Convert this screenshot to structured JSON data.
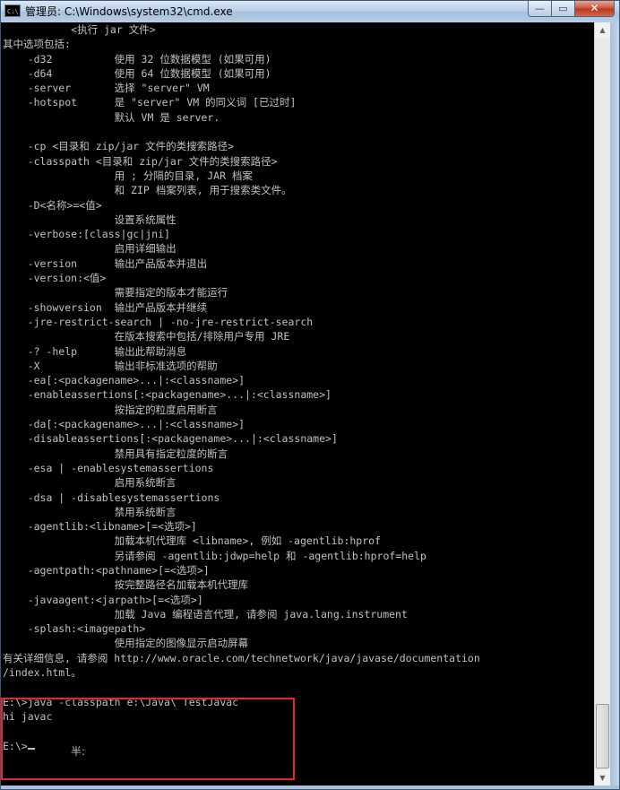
{
  "window": {
    "title": "管理员: C:\\Windows\\system32\\cmd.exe",
    "icon_text": "C:\\",
    "controls": {
      "minimize": "—",
      "maximize": "▭",
      "close": "✕"
    }
  },
  "console": {
    "lines": [
      "           <执行 jar 文件>",
      "其中选项包括:",
      "    -d32          使用 32 位数据模型 (如果可用)",
      "    -d64          使用 64 位数据模型 (如果可用)",
      "    -server       选择 \"server\" VM",
      "    -hotspot      是 \"server\" VM 的同义词 [已过时]",
      "                  默认 VM 是 server.",
      "",
      "    -cp <目录和 zip/jar 文件的类搜索路径>",
      "    -classpath <目录和 zip/jar 文件的类搜索路径>",
      "                  用 ; 分隔的目录, JAR 档案",
      "                  和 ZIP 档案列表, 用于搜索类文件。",
      "    -D<名称>=<值>",
      "                  设置系统属性",
      "    -verbose:[class|gc|jni]",
      "                  启用详细输出",
      "    -version      输出产品版本并退出",
      "    -version:<值>",
      "                  需要指定的版本才能运行",
      "    -showversion  输出产品版本并继续",
      "    -jre-restrict-search | -no-jre-restrict-search",
      "                  在版本搜索中包括/排除用户专用 JRE",
      "    -? -help      输出此帮助消息",
      "    -X            输出非标准选项的帮助",
      "    -ea[:<packagename>...|:<classname>]",
      "    -enableassertions[:<packagename>...|:<classname>]",
      "                  按指定的粒度启用断言",
      "    -da[:<packagename>...|:<classname>]",
      "    -disableassertions[:<packagename>...|:<classname>]",
      "                  禁用具有指定粒度的断言",
      "    -esa | -enablesystemassertions",
      "                  启用系统断言",
      "    -dsa | -disablesystemassertions",
      "                  禁用系统断言",
      "    -agentlib:<libname>[=<选项>]",
      "                  加载本机代理库 <libname>, 例如 -agentlib:hprof",
      "                  另请参阅 -agentlib:jdwp=help 和 -agentlib:hprof=help",
      "    -agentpath:<pathname>[=<选项>]",
      "                  按完整路径名加载本机代理库",
      "    -javaagent:<jarpath>[=<选项>]",
      "                  加载 Java 编程语言代理, 请参阅 java.lang.instrument",
      "    -splash:<imagepath>",
      "                  使用指定的图像显示启动屏幕",
      "有关详细信息, 请参阅 http://www.oracle.com/technetwork/java/javase/documentation",
      "/index.html。",
      "",
      "E:\\>java -classpath e:\\Java\\ TestJavac",
      "hi javac",
      ""
    ],
    "prompt": "E:\\>",
    "ime_status": "半:"
  },
  "scrollbar": {
    "up_arrow": "▲",
    "down_arrow": "▼"
  },
  "colors": {
    "console_background": "#000000",
    "console_text": "#c0c0c0",
    "highlight_border": "#e0282e",
    "titlebar": "#b8cde5"
  }
}
